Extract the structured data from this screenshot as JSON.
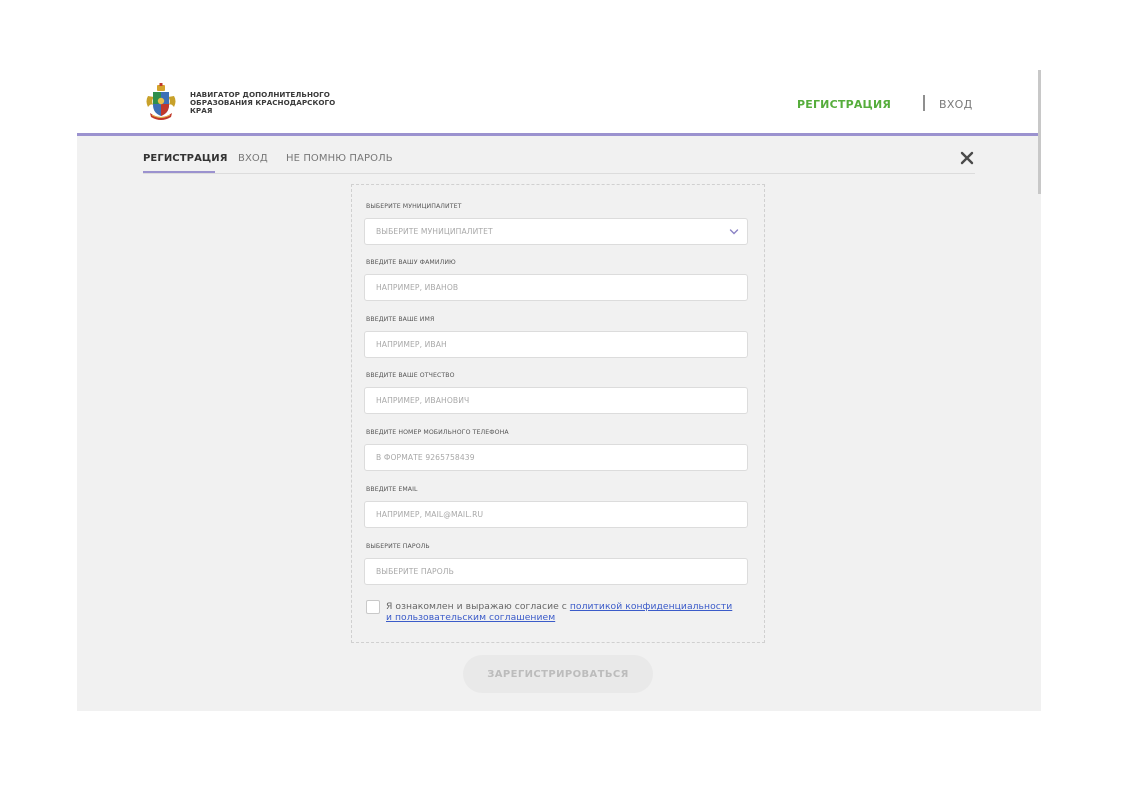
{
  "header": {
    "brand_lines": [
      "НАВИГАТОР ДОПОЛНИТЕЛЬНОГО",
      "ОБРАЗОВАНИЯ КРАСНОДАРСКОГО",
      "КРАЯ"
    ],
    "nav": {
      "register": "РЕГИСТРАЦИЯ",
      "login": "ВХОД"
    }
  },
  "tabs": {
    "register": "РЕГИСТРАЦИЯ",
    "login": "ВХОД",
    "forgot": "НЕ ПОМНЮ ПАРОЛЬ"
  },
  "form": {
    "municipality": {
      "label": "ВЫБЕРИТЕ МУНИЦИПАЛИТЕТ",
      "placeholder": "ВЫБЕРИТЕ МУНИЦИПАЛИТЕТ"
    },
    "last_name": {
      "label": "ВВЕДИТЕ ВАШУ ФАМИЛИЮ",
      "placeholder": "НАПРИМЕР, ИВАНОВ"
    },
    "first_name": {
      "label": "ВВЕДИТЕ ВАШЕ ИМЯ",
      "placeholder": "НАПРИМЕР, ИВАН"
    },
    "patronymic": {
      "label": "ВВЕДИТЕ ВАШЕ ОТЧЕСТВО",
      "placeholder": "НАПРИМЕР, ИВАНОВИЧ"
    },
    "phone": {
      "label": "ВВЕДИТЕ НОМЕР МОБИЛЬНОГО ТЕЛЕФОНА",
      "placeholder": "В ФОРМАТЕ 9265758439"
    },
    "email": {
      "label": "ВВЕДИТЕ EMAIL",
      "placeholder": "НАПРИМЕР, MAIL@MAIL.RU"
    },
    "password": {
      "label": "ВЫБЕРИТЕ ПАРОЛЬ",
      "placeholder": "ВЫБЕРИТЕ ПАРОЛЬ"
    },
    "consent": {
      "prefix": "Я ознакомлен и выражаю согласие с ",
      "privacy_link": "политикой конфиденциальности",
      "agreement_link": "и пользовательским соглашением"
    },
    "submit_label": "ЗАРЕГИСТРИРОВАТЬСЯ"
  },
  "colors": {
    "accent_green": "#56ad3c",
    "accent_purple": "#9b92cf",
    "link_blue": "#3b5bc9"
  },
  "icons": {
    "logo": "krasnodar-coat-of-arms-icon",
    "close": "close-icon",
    "select_arrow": "chevron-down-icon"
  }
}
